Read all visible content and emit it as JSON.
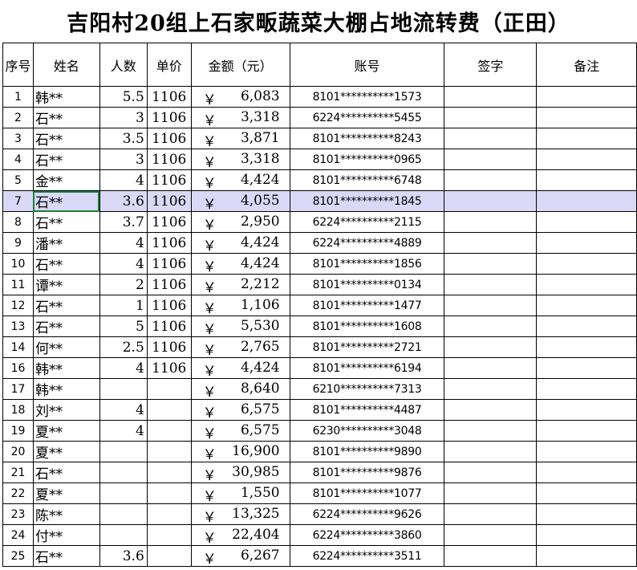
{
  "title": "吉阳村20组上石家畈蔬菜大棚占地流转费（正田）",
  "headers": [
    "序号",
    "姓名",
    "人数",
    "单价",
    "金额（元）",
    "账号",
    "签字",
    "备注"
  ],
  "currency_symbol": "￥",
  "rows": [
    {
      "idx": "1",
      "name": "韩**",
      "people": "5.5",
      "price": "1106",
      "amount": "6,083",
      "account": "8101**********1573",
      "sign": "",
      "note": ""
    },
    {
      "idx": "2",
      "name": "石**",
      "people": "3",
      "price": "1106",
      "amount": "3,318",
      "account": "6224**********5455",
      "sign": "",
      "note": ""
    },
    {
      "idx": "3",
      "name": "石**",
      "people": "3.5",
      "price": "1106",
      "amount": "3,871",
      "account": "8101**********8243",
      "sign": "",
      "note": ""
    },
    {
      "idx": "4",
      "name": "石**",
      "people": "3",
      "price": "1106",
      "amount": "3,318",
      "account": "8101**********0965",
      "sign": "",
      "note": ""
    },
    {
      "idx": "5",
      "name": "金**",
      "people": "4",
      "price": "1106",
      "amount": "4,424",
      "account": "8101**********6748",
      "sign": "",
      "note": ""
    },
    {
      "idx": "7",
      "name": "石**",
      "people": "3.6",
      "price": "1106",
      "amount": "4,055",
      "account": "8101**********1845",
      "sign": "",
      "note": ""
    },
    {
      "idx": "8",
      "name": "石**",
      "people": "3.7",
      "price": "1106",
      "amount": "2,950",
      "account": "6224**********2115",
      "sign": "",
      "note": ""
    },
    {
      "idx": "9",
      "name": "潘**",
      "people": "4",
      "price": "1106",
      "amount": "4,424",
      "account": "6224**********4889",
      "sign": "",
      "note": ""
    },
    {
      "idx": "10",
      "name": "石**",
      "people": "4",
      "price": "1106",
      "amount": "4,424",
      "account": "8101**********1856",
      "sign": "",
      "note": ""
    },
    {
      "idx": "11",
      "name": "谭**",
      "people": "2",
      "price": "1106",
      "amount": "2,212",
      "account": "8101**********0134",
      "sign": "",
      "note": ""
    },
    {
      "idx": "12",
      "name": "石**",
      "people": "1",
      "price": "1106",
      "amount": "1,106",
      "account": "8101**********1477",
      "sign": "",
      "note": ""
    },
    {
      "idx": "13",
      "name": "石**",
      "people": "5",
      "price": "1106",
      "amount": "5,530",
      "account": "8101**********1608",
      "sign": "",
      "note": ""
    },
    {
      "idx": "14",
      "name": "何**",
      "people": "2.5",
      "price": "1106",
      "amount": "2,765",
      "account": "8101**********2721",
      "sign": "",
      "note": ""
    },
    {
      "idx": "16",
      "name": "韩**",
      "people": "4",
      "price": "1106",
      "amount": "4,424",
      "account": "8101**********6194",
      "sign": "",
      "note": ""
    },
    {
      "idx": "17",
      "name": "韩**",
      "people": "",
      "price": "",
      "amount": "8,640",
      "account": "6210**********7313",
      "sign": "",
      "note": ""
    },
    {
      "idx": "18",
      "name": "刘**",
      "people": "4",
      "price": "",
      "amount": "6,575",
      "account": "8101**********4487",
      "sign": "",
      "note": ""
    },
    {
      "idx": "19",
      "name": "夏**",
      "people": "4",
      "price": "",
      "amount": "6,575",
      "account": "6230**********3048",
      "sign": "",
      "note": ""
    },
    {
      "idx": "20",
      "name": "夏**",
      "people": "",
      "price": "",
      "amount": "16,900",
      "account": "8101**********9890",
      "sign": "",
      "note": ""
    },
    {
      "idx": "21",
      "name": "石**",
      "people": "",
      "price": "",
      "amount": "30,985",
      "account": "8101**********9876",
      "sign": "",
      "note": ""
    },
    {
      "idx": "22",
      "name": "夏**",
      "people": "",
      "price": "",
      "amount": "1,550",
      "account": "8101**********1077",
      "sign": "",
      "note": ""
    },
    {
      "idx": "23",
      "name": "陈**",
      "people": "",
      "price": "",
      "amount": "13,325",
      "account": "6224**********9626",
      "sign": "",
      "note": ""
    },
    {
      "idx": "24",
      "name": "付**",
      "people": "",
      "price": "",
      "amount": "22,404",
      "account": "6224**********3860",
      "sign": "",
      "note": ""
    },
    {
      "idx": "25",
      "name": "石**",
      "people": "3.6",
      "price": "",
      "amount": "6,267",
      "account": "6224**********3511",
      "sign": "",
      "note": ""
    }
  ],
  "selected_row_index": 5,
  "colors": {
    "selection_fill": "#d9d9f7",
    "active_cell_border": "#1a7f3c",
    "grid": "#000000"
  }
}
